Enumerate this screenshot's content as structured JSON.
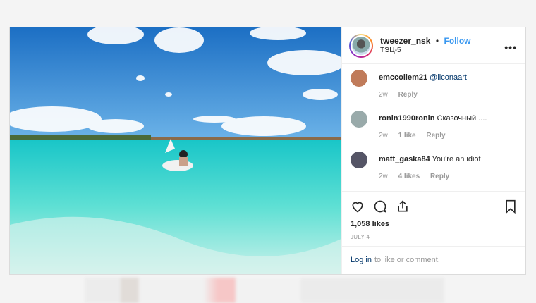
{
  "post": {
    "username": "tweezer_nsk",
    "follow_label": "Follow",
    "location": "ТЭЦ-5",
    "more_label": "•••",
    "likes": "1,058 likes",
    "date": "JULY 4"
  },
  "comments": [
    {
      "user": "emccollem21",
      "text": "@liconaart",
      "time": "2w",
      "likes": "",
      "reply": "Reply",
      "avatar_color": "#c07b5a"
    },
    {
      "user": "ronin1990ronin",
      "text": "Сказочный ....",
      "time": "2w",
      "likes": "1 like",
      "reply": "Reply",
      "avatar_color": "#9aa"
    },
    {
      "user": "matt_gaska84",
      "text": "You're an idiot",
      "time": "2w",
      "likes": "4 likes",
      "reply": "Reply",
      "avatar_color": "#556"
    }
  ],
  "login": {
    "link": "Log in",
    "rest": "to like or comment."
  },
  "icons": [
    "heart-icon",
    "comment-icon",
    "share-icon",
    "bookmark-icon"
  ],
  "colors": {
    "accent": "#3897f0",
    "text": "#262626",
    "muted": "#999999"
  }
}
